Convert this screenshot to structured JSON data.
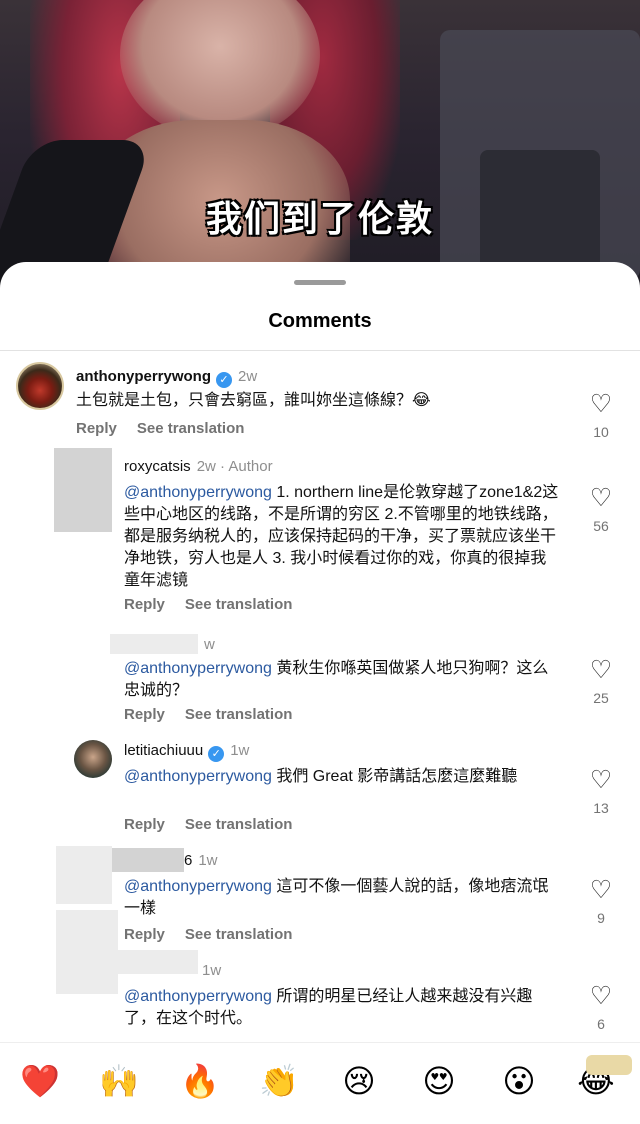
{
  "video": {
    "subtitle": "我们到了伦敦"
  },
  "sheet": {
    "title": "Comments"
  },
  "comments": [
    {
      "user": "anthonyperrywong",
      "verified": true,
      "time": "2w",
      "text": "土包就是土包，只會去窮區，誰叫妳坐這條線？😂",
      "reply_label": "Reply",
      "translate_label": "See translation",
      "likes": "10"
    },
    {
      "user": "roxycatsis",
      "meta": "2w · Author",
      "mention": "@anthonyperrywong",
      "text": " 1. northern line是伦敦穿越了zone1&2这些中心地区的线路，不是所谓的穷区 2.不管哪里的地铁线路，都是服务纳税人的，应该保持起码的干净，买了票就应该坐干净地铁，穷人也是人 3. 我小时候看过你的戏，你真的很掉我童年滤镜",
      "reply_label": "Reply",
      "translate_label": "See translation",
      "likes": "56"
    },
    {
      "user": "",
      "meta": "w",
      "mention": "@anthonyperrywong",
      "text": " 黄秋生你喺英国做紧人地只狗啊？这么忠诚的？",
      "reply_label": "Reply",
      "translate_label": "See translation",
      "likes": "25"
    },
    {
      "user": "letitiachiuuu",
      "verified": true,
      "time": "1w",
      "mention": "@anthonyperrywong",
      "text": " 我們 Great 影帝講話怎麼這麼難聽",
      "reply_label": "Reply",
      "translate_label": "See translation",
      "likes": "13"
    },
    {
      "user": "6",
      "meta": "1w",
      "mention": "@anthonyperrywong",
      "text": " 這可不像一個藝人說的話，像地痞流氓一樣",
      "reply_label": "Reply",
      "translate_label": "See translation",
      "likes": "9"
    },
    {
      "user": "",
      "meta": "1w",
      "mention": "@anthonyperrywong",
      "text": " 所谓的明星已经让人越来越没有兴趣了，在这个时代。",
      "likes": "6"
    }
  ],
  "reactions": [
    "❤️",
    "🙌",
    "🔥",
    "👏",
    "😢",
    "😍",
    "😮",
    "😂"
  ],
  "icons": {
    "like": "heart-outline-icon",
    "verified": "verified-badge-icon"
  },
  "colors": {
    "mention": "#2c5aa0",
    "verified": "#3897f0",
    "meta": "#8e8e8e"
  }
}
